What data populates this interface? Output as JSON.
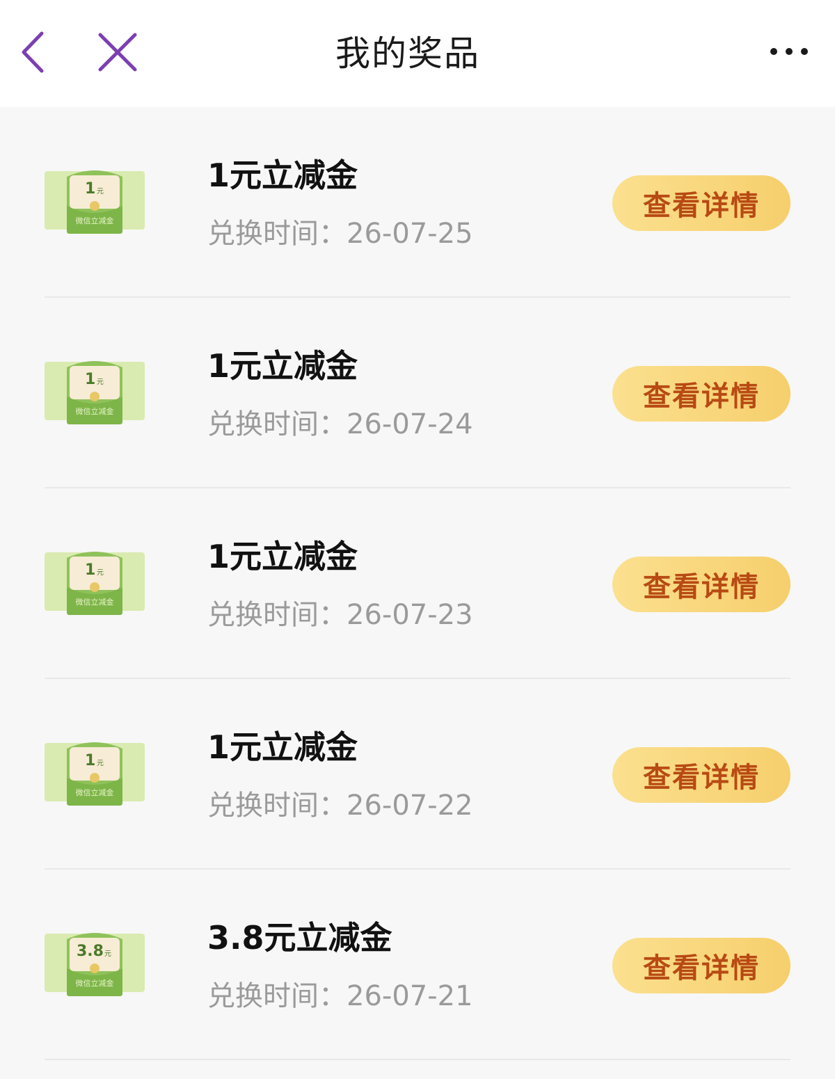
{
  "nav": {
    "title": "我的奖品",
    "back_icon": "chevron-left-icon",
    "close_icon": "close-icon",
    "more_icon": "more-horizontal-icon",
    "accent_color": "#7b3fb1"
  },
  "prizes": [
    {
      "amount": "1",
      "unit": "元",
      "badge_text": "微信立减金",
      "title": "1元立减金",
      "date_label": "兑换时间：",
      "date": "26-07-25",
      "button_label": "查看详情"
    },
    {
      "amount": "1",
      "unit": "元",
      "badge_text": "微信立减金",
      "title": "1元立减金",
      "date_label": "兑换时间：",
      "date": "26-07-24",
      "button_label": "查看详情"
    },
    {
      "amount": "1",
      "unit": "元",
      "badge_text": "微信立减金",
      "title": "1元立减金",
      "date_label": "兑换时间：",
      "date": "26-07-23",
      "button_label": "查看详情"
    },
    {
      "amount": "1",
      "unit": "元",
      "badge_text": "微信立减金",
      "title": "1元立减金",
      "date_label": "兑换时间：",
      "date": "26-07-22",
      "button_label": "查看详情"
    },
    {
      "amount": "3.8",
      "unit": "元",
      "badge_text": "微信立减金",
      "title": "3.8元立减金",
      "date_label": "兑换时间：",
      "date": "26-07-21",
      "button_label": "查看详情"
    }
  ]
}
